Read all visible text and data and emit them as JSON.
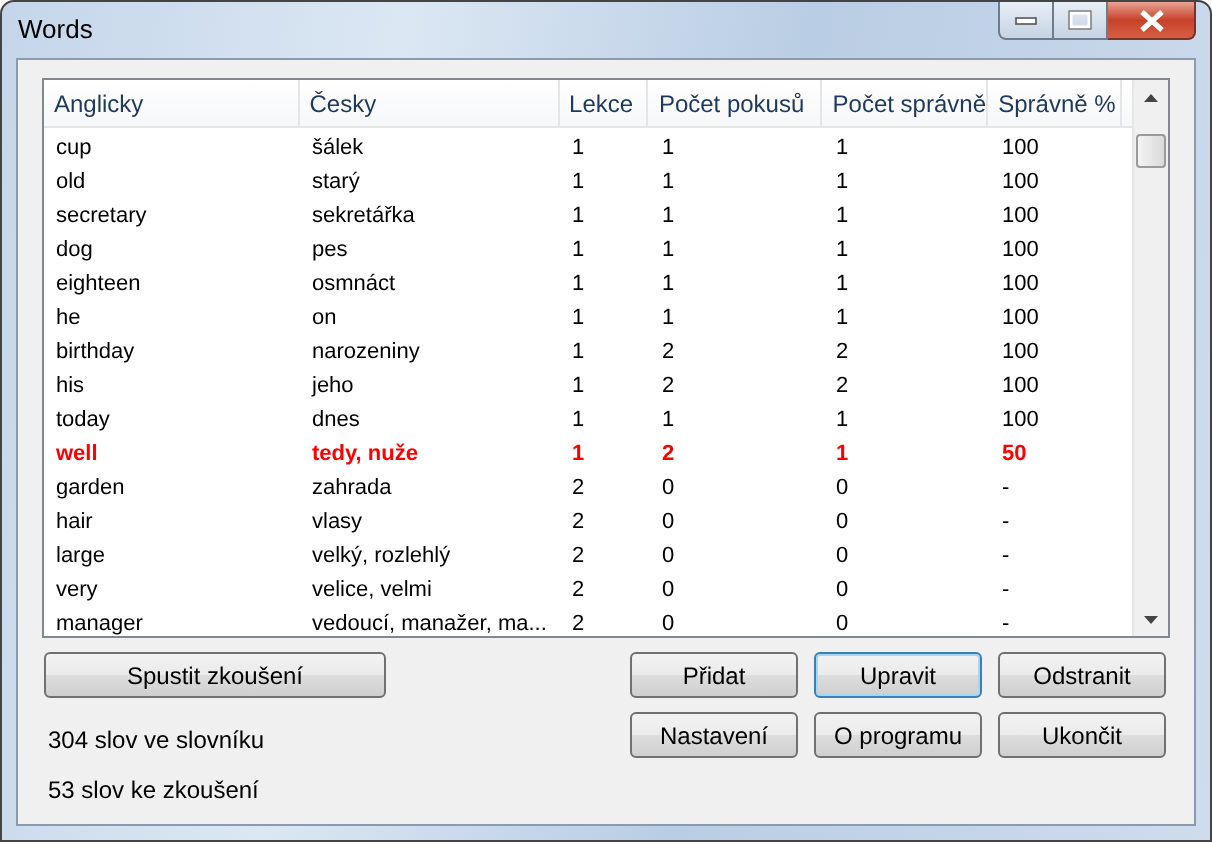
{
  "window": {
    "title": "Words"
  },
  "table": {
    "columns": [
      "Anglicky",
      "Česky",
      "Lekce",
      "Počet pokusů",
      "Počet správně",
      "Správně %"
    ],
    "rows": [
      {
        "cells": [
          "cup",
          "šálek",
          "1",
          "1",
          "1",
          "100"
        ],
        "highlighted": false
      },
      {
        "cells": [
          "old",
          "starý",
          "1",
          "1",
          "1",
          "100"
        ],
        "highlighted": false
      },
      {
        "cells": [
          "secretary",
          "sekretářka",
          "1",
          "1",
          "1",
          "100"
        ],
        "highlighted": false
      },
      {
        "cells": [
          "dog",
          "pes",
          "1",
          "1",
          "1",
          "100"
        ],
        "highlighted": false
      },
      {
        "cells": [
          "eighteen",
          "osmnáct",
          "1",
          "1",
          "1",
          "100"
        ],
        "highlighted": false
      },
      {
        "cells": [
          "he",
          "on",
          "1",
          "1",
          "1",
          "100"
        ],
        "highlighted": false
      },
      {
        "cells": [
          "birthday",
          "narozeniny",
          "1",
          "2",
          "2",
          "100"
        ],
        "highlighted": false
      },
      {
        "cells": [
          "his",
          "jeho",
          "1",
          "2",
          "2",
          "100"
        ],
        "highlighted": false
      },
      {
        "cells": [
          "today",
          "dnes",
          "1",
          "1",
          "1",
          "100"
        ],
        "highlighted": false
      },
      {
        "cells": [
          "well",
          "tedy, nuže",
          "1",
          "2",
          "1",
          "50"
        ],
        "highlighted": true
      },
      {
        "cells": [
          "garden",
          "zahrada",
          "2",
          "0",
          "0",
          "-"
        ],
        "highlighted": false
      },
      {
        "cells": [
          "hair",
          "vlasy",
          "2",
          "0",
          "0",
          "-"
        ],
        "highlighted": false
      },
      {
        "cells": [
          "large",
          "velký, rozlehlý",
          "2",
          "0",
          "0",
          "-"
        ],
        "highlighted": false
      },
      {
        "cells": [
          "very",
          "velice, velmi",
          "2",
          "0",
          "0",
          "-"
        ],
        "highlighted": false
      },
      {
        "cells": [
          "manager",
          "vedoucí, manažer, ma...",
          "2",
          "0",
          "0",
          "-"
        ],
        "highlighted": false
      }
    ]
  },
  "start_button": {
    "label": "Spustit zkoušení"
  },
  "buttons": [
    {
      "label": "Přidat",
      "default": false
    },
    {
      "label": "Upravit",
      "default": true
    },
    {
      "label": "Odstranit",
      "default": false
    },
    {
      "label": "Nastavení",
      "default": false
    },
    {
      "label": "O programu",
      "default": false
    },
    {
      "label": "Ukončit",
      "default": false
    }
  ],
  "status": [
    "304 slov ve slovníku",
    "53 slov ke zkoušení"
  ]
}
